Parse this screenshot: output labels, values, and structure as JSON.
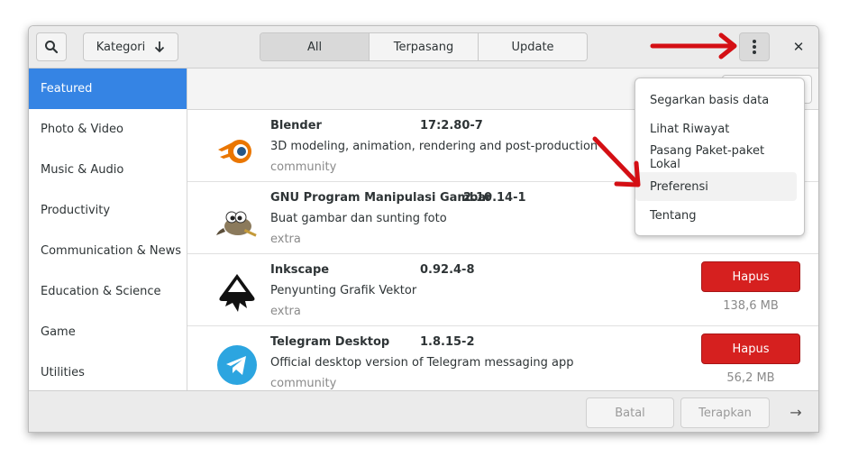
{
  "header": {
    "kategori_label": "Kategori",
    "tabs": [
      {
        "label": "All"
      },
      {
        "label": "Terpasang"
      },
      {
        "label": "Update"
      }
    ],
    "close_glyph": "✕"
  },
  "sidebar": {
    "items": [
      {
        "label": "Featured"
      },
      {
        "label": "Photo & Video"
      },
      {
        "label": "Music & Audio"
      },
      {
        "label": "Productivity"
      },
      {
        "label": "Communication & News"
      },
      {
        "label": "Education & Science"
      },
      {
        "label": "Game"
      },
      {
        "label": "Utilities"
      }
    ]
  },
  "apps": [
    {
      "name": "Blender",
      "version": "17:2.80-7",
      "description": "3D modeling, animation, rendering and post-production",
      "repo": "community",
      "icon": "blender-icon"
    },
    {
      "name": "GNU Program Manipulasi Gambar",
      "version": "2.10.14-1",
      "description": "Buat gambar dan sunting foto",
      "repo": "extra",
      "icon": "gimp-icon"
    },
    {
      "name": "Inkscape",
      "version": "0.92.4-8",
      "description": "Penyunting Grafik Vektor",
      "repo": "extra",
      "icon": "inkscape-icon",
      "action": "Hapus",
      "size": "138,6 MB"
    },
    {
      "name": "Telegram Desktop",
      "version": "1.8.15-2",
      "description": "Official desktop version of Telegram messaging app",
      "repo": "community",
      "icon": "telegram-icon",
      "action": "Hapus",
      "size": "56,2 MB"
    }
  ],
  "menu": {
    "items": [
      {
        "label": "Segarkan basis data"
      },
      {
        "label": "Lihat Riwayat"
      },
      {
        "label": "Pasang Paket-paket Lokal"
      },
      {
        "label": "Preferensi"
      },
      {
        "label": "Tentang"
      }
    ]
  },
  "actionbar": {
    "cancel_label": "Batal",
    "apply_label": "Terapkan",
    "next_glyph": "→"
  },
  "colors": {
    "accent": "#3584e4",
    "destructive": "#d6201f",
    "annotation_arrow": "#d40f14"
  }
}
